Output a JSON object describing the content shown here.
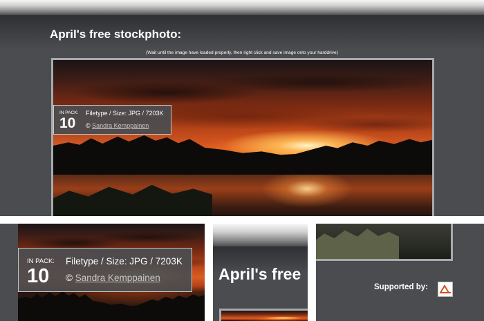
{
  "header": {
    "title": "April's free stockphoto:",
    "title_cropped": "April's free",
    "instructions": "(Wait until the image have loaded properly, then right click and save image onto your harddrive)"
  },
  "photo_info": {
    "pack_label": "IN PACK:",
    "pack_count": "10",
    "filetype_text": "Filetype / Size: JPG / 7203K",
    "copyright_symbol": "©",
    "author_link": "Sandra Kemppainen"
  },
  "footer": {
    "supported_by_label": "Supported by:",
    "sponsor_icon": "sponsor-logo-icon"
  },
  "colors": {
    "panel_bg": "#4b4c50",
    "text": "#ffffff",
    "link": "#c8c8c8",
    "frame": "#a9aaac"
  }
}
